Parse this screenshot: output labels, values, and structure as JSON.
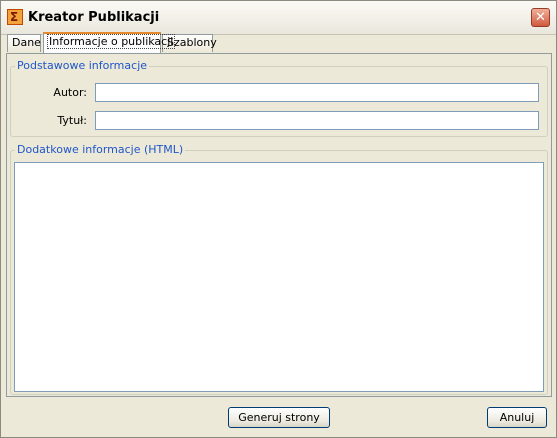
{
  "window": {
    "title": "Kreator Publikacji",
    "close_symbol": "✕"
  },
  "tabs": [
    {
      "label": "Dane",
      "active": false
    },
    {
      "label": "Informacje o publikacji",
      "active": true
    },
    {
      "label": "Szablony",
      "active": false
    }
  ],
  "basic_info": {
    "legend": "Podstawowe informacje",
    "author_label": "Autor:",
    "author_value": "",
    "title_label": "Tytuł:",
    "title_value": ""
  },
  "extra_info": {
    "legend": "Dodatkowe informacje (HTML)",
    "html_value": ""
  },
  "footer": {
    "generate_label": "Generuj strony",
    "cancel_label": "Anuluj"
  }
}
